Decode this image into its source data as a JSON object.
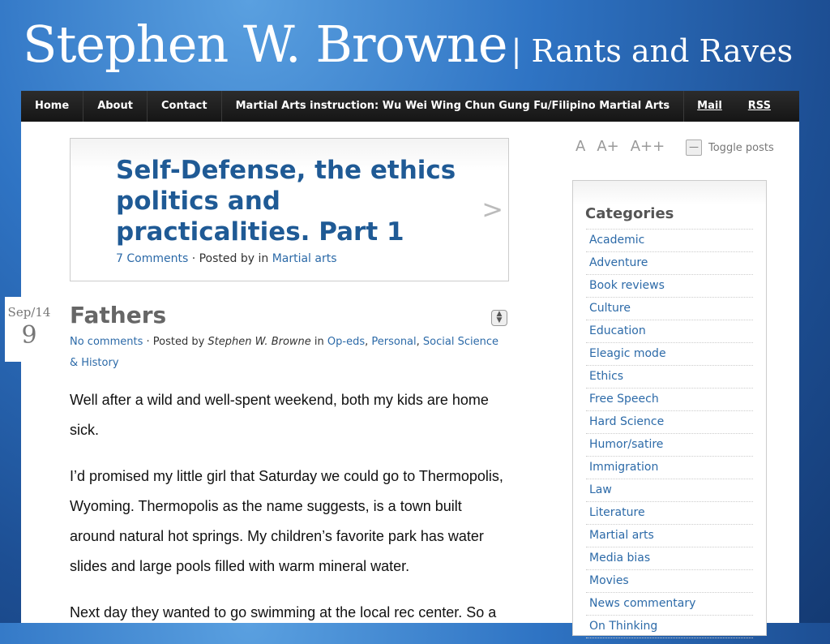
{
  "header": {
    "title": "Stephen W. Browne",
    "tagline": "| Rants and Raves"
  },
  "nav": [
    "Home",
    "About",
    "Contact",
    "Martial Arts instruction: Wu Wei Wing Chun Gung Fu/Filipino Martial Arts",
    "Mail",
    "RSS"
  ],
  "featured": {
    "title": "Self-Defense, the ethics politics and practicalities. Part 1",
    "comments": "7 Comments",
    "posted_by": " · Posted by  in ",
    "category": "Martial arts",
    "next_arrow": ">"
  },
  "date": {
    "month": "Sep/14",
    "day": "9"
  },
  "post": {
    "title": "Fathers",
    "comments": "No comments",
    "posted_by": " · Posted by ",
    "author": "Stephen W. Browne",
    "in": " in ",
    "cat1": "Op-eds",
    "cat2": "Personal",
    "cat3": "Social Science & History",
    "p1": "Well after a wild and well-spent weekend, both my kids are home sick.",
    "p2": "I’d promised my little girl that Saturday we could go to Thermopolis, Wyoming. Thermopolis as the name suggests, is a town built around natural hot springs. My children’s favorite park has water slides and large pools filled with warm mineral water.",
    "p3": "Next day they wanted to go swimming at the local rec center. So a"
  },
  "font_sizer": [
    "A",
    "A+",
    "A++"
  ],
  "toggle_posts": "Toggle posts",
  "toggle_symbol": "—",
  "sidebar": {
    "title": "Categories",
    "categories": [
      "Academic",
      "Adventure",
      "Book reviews",
      "Culture",
      "Education",
      "Eleagic mode",
      "Ethics",
      "Free Speech",
      "Hard Science",
      "Humor/satire",
      "Immigration",
      "Law",
      "Literature",
      "Martial arts",
      "Media bias",
      "Movies",
      "News commentary",
      "On Thinking"
    ]
  }
}
